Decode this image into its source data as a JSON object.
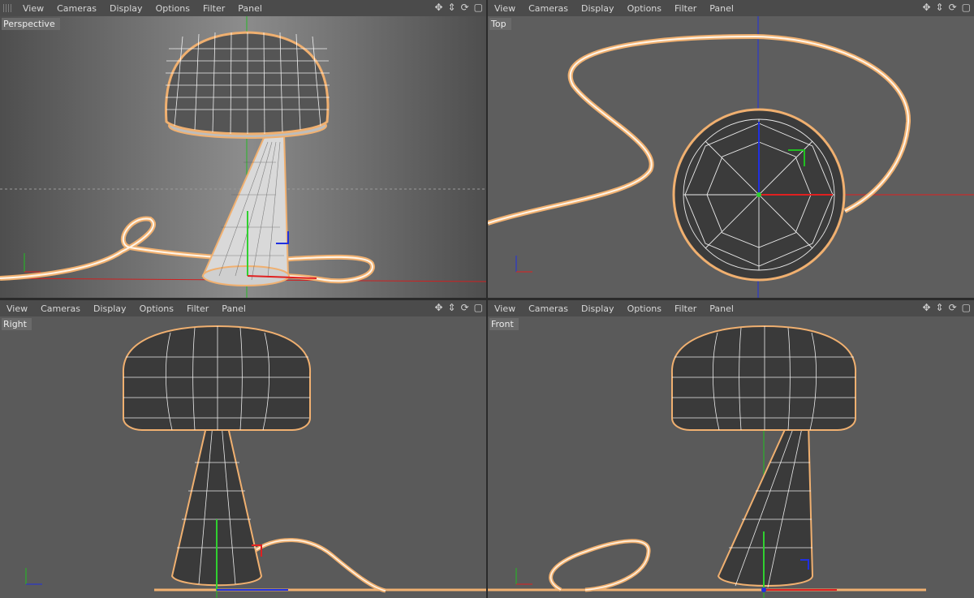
{
  "menu": [
    "View",
    "Cameras",
    "Display",
    "Options",
    "Filter",
    "Panel"
  ],
  "nav_icons": [
    "move-icon",
    "zoom-icon",
    "rotate-icon",
    "maximize-icon"
  ],
  "viewports": {
    "perspective": {
      "label": "Perspective"
    },
    "top": {
      "label": "Top"
    },
    "right": {
      "label": "Right"
    },
    "front": {
      "label": "Front"
    }
  },
  "colors": {
    "accent": "#f0b070",
    "wire": "#ffffff",
    "axis_x": "#e02020",
    "axis_y": "#20c020",
    "axis_z": "#2030e0",
    "bg": "#5a5a5a"
  }
}
